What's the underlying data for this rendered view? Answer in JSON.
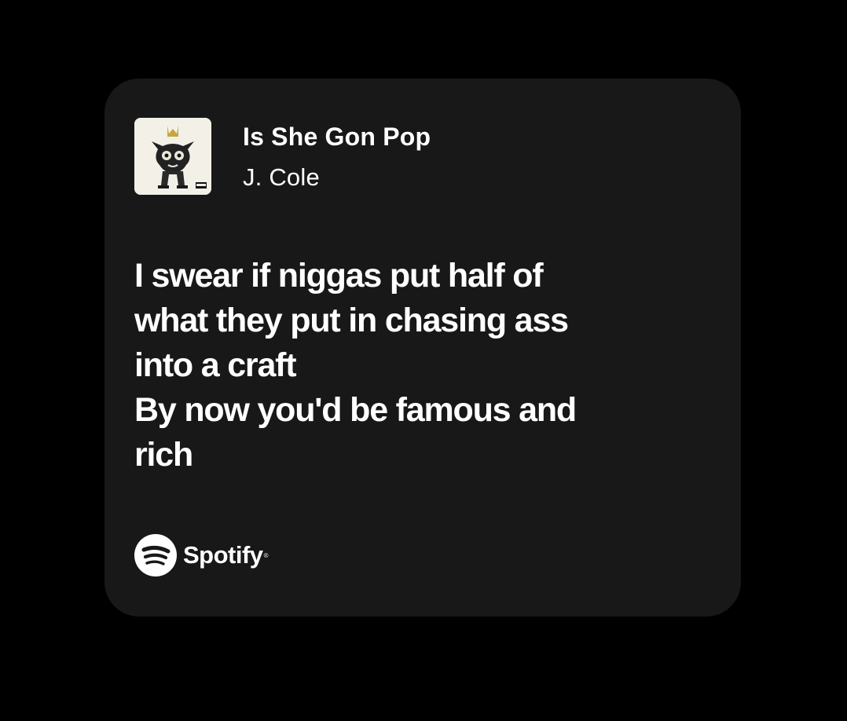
{
  "song": {
    "title": "Is She Gon Pop",
    "artist": "J. Cole",
    "cover_art": "album-cover-image"
  },
  "lyrics": {
    "lines": [
      "I swear if niggas put half of",
      "what they put in chasing ass",
      "into a craft",
      "By now you'd be famous and",
      "rich"
    ]
  },
  "brand": {
    "name": "Spotify",
    "icon": "spotify-logo-icon"
  },
  "colors": {
    "background": "#000000",
    "card": "#181818",
    "text": "#ffffff"
  }
}
